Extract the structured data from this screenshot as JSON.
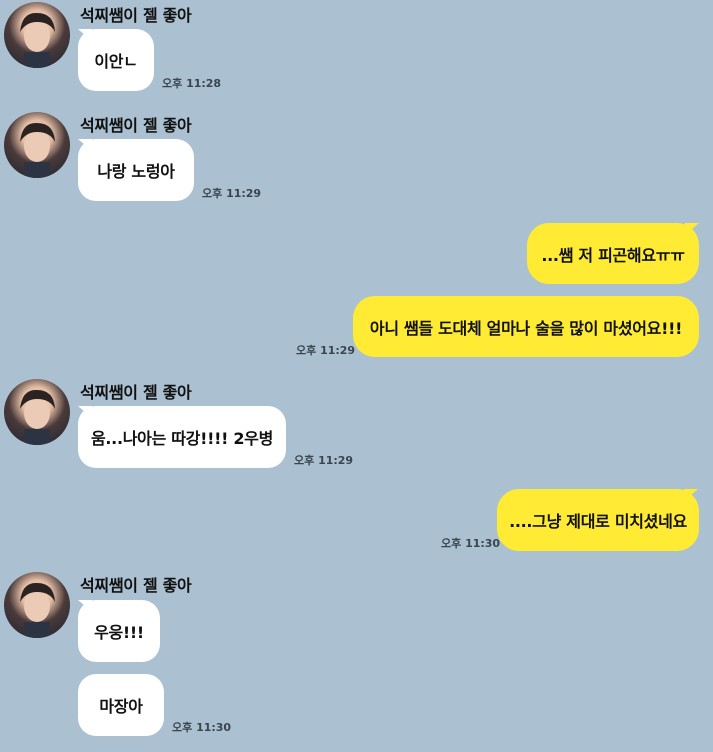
{
  "chat": {
    "groups": [
      {
        "sender": "석찌쌤이 젤 좋아",
        "messages": [
          {
            "text": "이안ㄴ",
            "time": "오후 11:28"
          }
        ]
      },
      {
        "sender": "석찌쌤이 젤 좋아",
        "messages": [
          {
            "text": "나랑 노렁아",
            "time": "오후 11:29"
          }
        ]
      },
      {
        "sender": "me",
        "messages": [
          {
            "text": "...쌤 저 피곤해요ㅠㅠ"
          },
          {
            "text": "아니 쌤들 도대체 얼마나 술을 많이 마셨어요!!!",
            "time": "오후 11:29"
          }
        ]
      },
      {
        "sender": "석찌쌤이 젤 좋아",
        "messages": [
          {
            "text": "움...나아는 따강!!!! 2우병",
            "time": "오후 11:29"
          }
        ]
      },
      {
        "sender": "me",
        "messages": [
          {
            "text": "....그냥 제대로 미치셨네요",
            "time": "오후 11:30"
          }
        ]
      },
      {
        "sender": "석찌쌤이 젤 좋아",
        "messages": [
          {
            "text": "우웅!!!"
          },
          {
            "text": "마장아",
            "time": "오후 11:30"
          }
        ]
      }
    ]
  },
  "colors": {
    "background": "#abc1d1",
    "incoming_bubble": "#ffffff",
    "outgoing_bubble": "#ffeb33"
  },
  "icons": {
    "avatar": "profile-photo"
  }
}
